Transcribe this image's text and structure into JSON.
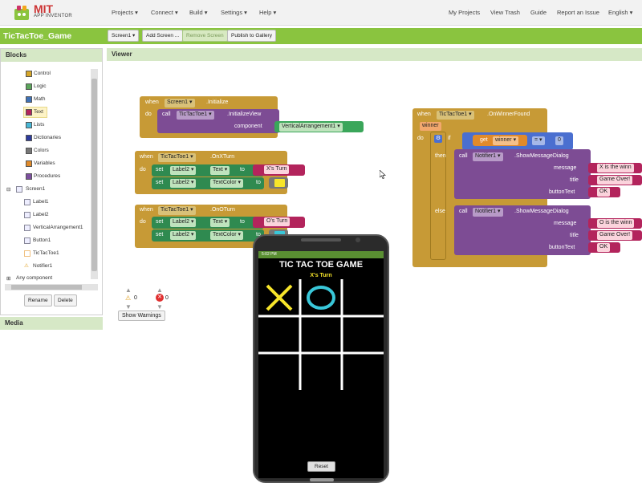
{
  "app": {
    "logo_title": "MIT",
    "logo_subtitle": "APP INVENTOR",
    "menu": [
      "Projects ▾",
      "Connect ▾",
      "Build ▾",
      "Settings ▾",
      "Help ▾"
    ],
    "right_menu": [
      "My Projects",
      "View Trash",
      "Guide",
      "Report an Issue",
      "English ▾"
    ]
  },
  "toolbar": {
    "project_name": "TicTacToe_Game",
    "screen_select": "Screen1 ▾",
    "add_screen": "Add Screen ...",
    "remove_screen": "Remove Screen",
    "publish": "Publish to Gallery"
  },
  "blocks_panel": {
    "title": "Blocks",
    "builtin": [
      {
        "label": "Control",
        "color": "#d6a628"
      },
      {
        "label": "Logic",
        "color": "#5ba55b"
      },
      {
        "label": "Math",
        "color": "#3f71b5"
      },
      {
        "label": "Text",
        "color": "#b3245c"
      },
      {
        "label": "Lists",
        "color": "#48b7d6"
      },
      {
        "label": "Dictionaries",
        "color": "#2d3b9c"
      },
      {
        "label": "Colors",
        "color": "#777777"
      },
      {
        "label": "Variables",
        "color": "#e08a2a"
      },
      {
        "label": "Procedures",
        "color": "#7c4f9e"
      }
    ],
    "screen": "Screen1",
    "components": [
      "Label1",
      "Label2",
      "VerticalArrangement1",
      "Button1",
      "TicTacToe1",
      "Notifier1"
    ],
    "any_component": "Any component",
    "rename": "Rename",
    "delete": "Delete",
    "media": "Media"
  },
  "viewer": {
    "title": "Viewer",
    "warnings_count": "0",
    "errors_count": "0",
    "show_warnings": "Show Warnings"
  },
  "blocks": {
    "init": {
      "when": "when",
      "comp": "Screen1 ▾",
      "event": ".Initialize",
      "do": "do",
      "call": "call",
      "call_comp": "TicTacToe1 ▾",
      "method": ".InitializeView",
      "arg_label": "component",
      "arg_value": "VerticalArrangement1 ▾"
    },
    "xturn": {
      "when": "when",
      "comp": "TicTacToe1 ▾",
      "event": ".OnXTurn",
      "do": "do",
      "set1": "set",
      "set1_comp": "Label2 ▾",
      "set1_prop": "Text ▾",
      "set1_to": "to",
      "set1_val": "X's Turn",
      "set2": "set",
      "set2_comp": "Label2 ▾",
      "set2_prop": "TextColor ▾",
      "set2_to": "to",
      "set2_color": "#f7e52a"
    },
    "oturn": {
      "when": "when",
      "comp": "TicTacToe1 ▾",
      "event": ".OnOTurn",
      "do": "do",
      "set1": "set",
      "set1_comp": "Label2 ▾",
      "set1_prop": "Text ▾",
      "set1_to": "to",
      "set1_val": "O's Turn",
      "set2": "set",
      "set2_comp": "Label2 ▾",
      "set2_prop": "TextColor ▾",
      "set2_to": "to",
      "set2_color": "#39c7d9"
    },
    "winner": {
      "when": "when",
      "comp": "TicTacToe1 ▾",
      "event": ".OnWinnerFound",
      "param": "winner",
      "do": "do",
      "if": "if",
      "get": "get",
      "get_var": "winner ▾",
      "op": "= ▾",
      "num": "0",
      "then": "then",
      "else": "else",
      "call": "call",
      "notifier": "Notifier1 ▾",
      "method": ".ShowMessageDialog",
      "message": "message",
      "title": "title",
      "button_text": "buttonText",
      "then_message": "X is the winn",
      "then_title": "Game Over!",
      "then_button": "OK",
      "else_message": "O is the winn",
      "else_title": "Game Over!",
      "else_button": "OK"
    }
  },
  "phone": {
    "status_time": "5:02 PM",
    "title": "TIC TAC TOE GAME",
    "turn": "X's Turn",
    "turn_color": "#f7e52a",
    "board": [
      "X",
      "O",
      "",
      "",
      "",
      "",
      "",
      "",
      ""
    ],
    "x_color": "#f7e52a",
    "o_color": "#39c7d9",
    "reset": "Reset"
  }
}
